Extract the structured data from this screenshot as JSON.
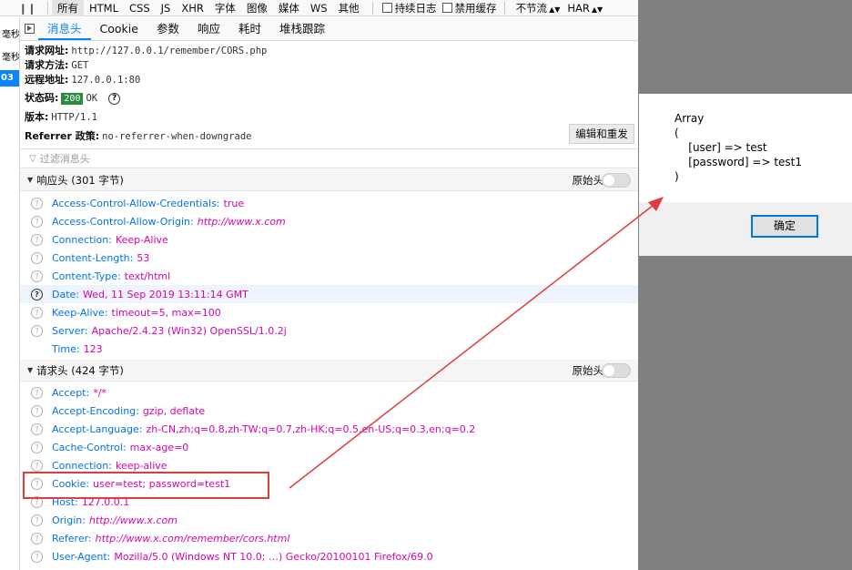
{
  "toolbar": {
    "pause": "❙❙",
    "filters": [
      "所有",
      "HTML",
      "CSS",
      "JS",
      "XHR",
      "字体",
      "图像",
      "媒体",
      "WS",
      "其他"
    ],
    "persist_logs": "持续日志",
    "disable_cache": "禁用缓存",
    "throttle": "不节流",
    "har": "HAR"
  },
  "request_list": {
    "col1": "毫秒",
    "col2": "毫秒",
    "selected": "03"
  },
  "detail_tabs": [
    "消息头",
    "Cookie",
    "参数",
    "响应",
    "耗时",
    "堆栈跟踪"
  ],
  "summary": {
    "url_label": "请求网址:",
    "url": "http://127.0.0.1/remember/CORS.php",
    "method_label": "请求方法:",
    "method": "GET",
    "remote_label": "远程地址:",
    "remote": "127.0.0.1:80",
    "status_label": "状态码:",
    "status_code": "200",
    "status_text": "OK",
    "version_label": "版本:",
    "version": "HTTP/1.1",
    "referrer_label": "Referrer 政策:",
    "referrer": "no-referrer-when-downgrade",
    "resend_button": "编辑和重发",
    "filter_placeholder": "过滤消息头"
  },
  "response_headers": {
    "title": "响应头 (301 字节)",
    "raw_label": "原始头",
    "items": [
      {
        "k": "Access-Control-Allow-Credentials:",
        "v": "true"
      },
      {
        "k": "Access-Control-Allow-Origin:",
        "v": "http://www.x.com"
      },
      {
        "k": "Connection:",
        "v": "Keep-Alive"
      },
      {
        "k": "Content-Length:",
        "v": "53"
      },
      {
        "k": "Content-Type:",
        "v": "text/html"
      },
      {
        "k": "Date:",
        "v": "Wed, 11 Sep 2019 13:11:14 GMT"
      },
      {
        "k": "Keep-Alive:",
        "v": "timeout=5, max=100"
      },
      {
        "k": "Server:",
        "v": "Apache/2.4.23 (Win32) OpenSSL/1.0.2j"
      },
      {
        "k": "Time:",
        "v": "123"
      }
    ]
  },
  "request_headers": {
    "title": "请求头 (424 字节)",
    "raw_label": "原始头",
    "items": [
      {
        "k": "Accept:",
        "v": "*/*"
      },
      {
        "k": "Accept-Encoding:",
        "v": "gzip, deflate"
      },
      {
        "k": "Accept-Language:",
        "v": "zh-CN,zh;q=0.8,zh-TW;q=0.7,zh-HK;q=0.5,en-US;q=0.3,en;q=0.2"
      },
      {
        "k": "Cache-Control:",
        "v": "max-age=0"
      },
      {
        "k": "Connection:",
        "v": "keep-alive"
      },
      {
        "k": "Cookie:",
        "v": "user=test; password=test1"
      },
      {
        "k": "Host:",
        "v": "127.0.0.1"
      },
      {
        "k": "Origin:",
        "v": "http://www.x.com"
      },
      {
        "k": "Referer:",
        "v": "http://www.x.com/remember/cors.html"
      },
      {
        "k": "User-Agent:",
        "v": "Mozilla/5.0 (Windows NT 10.0; …) Gecko/20100101 Firefox/69.0"
      }
    ]
  },
  "dialog": {
    "message": "Array\n(\n    [user] => test\n    [password] => test1\n)",
    "ok_button": "确定"
  },
  "colors": {
    "header_name": "#0074e8",
    "header_value": "#dd00a9",
    "accent": "#0a84ff",
    "annotation": "#e03c3c",
    "status_ok": "#2b8a3e"
  }
}
